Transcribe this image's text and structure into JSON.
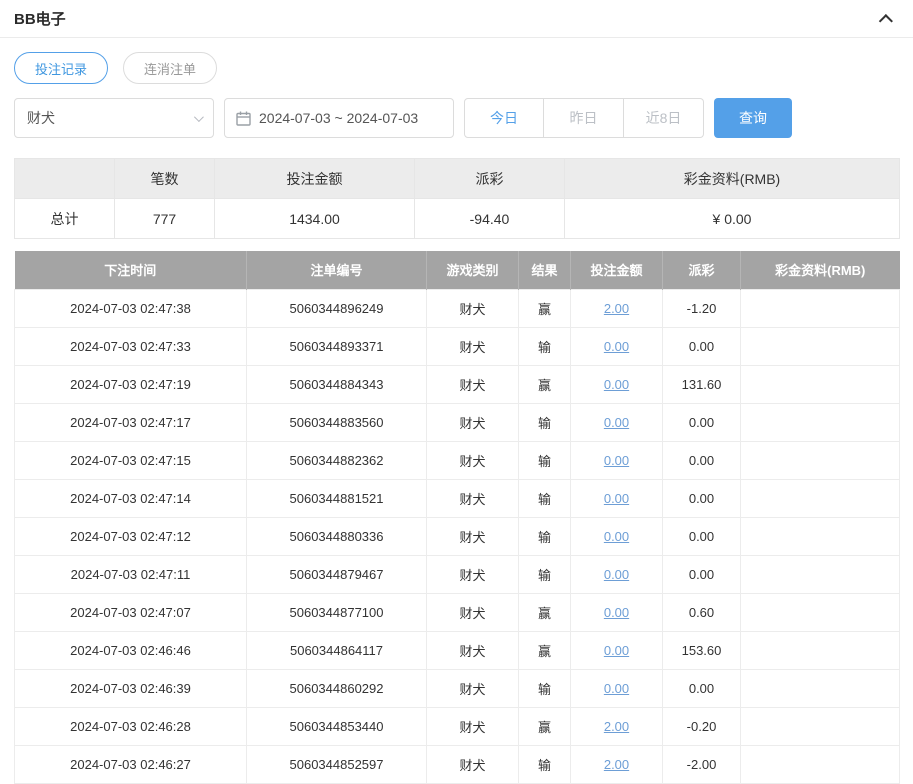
{
  "panel": {
    "title": "BB电子"
  },
  "tabs": {
    "bet_records": "投注记录",
    "cancelled_orders": "连消注单"
  },
  "filters": {
    "game_select_value": "财犬",
    "date_range_value": "2024-07-03 ~ 2024-07-03",
    "btn_today": "今日",
    "btn_yesterday": "昨日",
    "btn_last8": "近8日",
    "btn_search": "查询"
  },
  "summary": {
    "headers": {
      "blank": "",
      "count": "笔数",
      "bet_amount": "投注金额",
      "payout": "派彩",
      "bonus": "彩金资料(RMB)"
    },
    "total_label": "总计",
    "count": "777",
    "bet_amount": "1434.00",
    "payout": "-94.40",
    "bonus": "¥ 0.00"
  },
  "table": {
    "headers": [
      "下注时间",
      "注单编号",
      "游戏类别",
      "结果",
      "投注金额",
      "派彩",
      "彩金资料(RMB)"
    ],
    "rows": [
      {
        "time": "2024-07-03 02:47:38",
        "order_id": "5060344896249",
        "game": "财犬",
        "result": "赢",
        "amount": "2.00",
        "payout": "-1.20",
        "bonus": ""
      },
      {
        "time": "2024-07-03 02:47:33",
        "order_id": "5060344893371",
        "game": "财犬",
        "result": "输",
        "amount": "0.00",
        "payout": "0.00",
        "bonus": ""
      },
      {
        "time": "2024-07-03 02:47:19",
        "order_id": "5060344884343",
        "game": "财犬",
        "result": "赢",
        "amount": "0.00",
        "payout": "131.60",
        "bonus": ""
      },
      {
        "time": "2024-07-03 02:47:17",
        "order_id": "5060344883560",
        "game": "财犬",
        "result": "输",
        "amount": "0.00",
        "payout": "0.00",
        "bonus": ""
      },
      {
        "time": "2024-07-03 02:47:15",
        "order_id": "5060344882362",
        "game": "财犬",
        "result": "输",
        "amount": "0.00",
        "payout": "0.00",
        "bonus": ""
      },
      {
        "time": "2024-07-03 02:47:14",
        "order_id": "5060344881521",
        "game": "财犬",
        "result": "输",
        "amount": "0.00",
        "payout": "0.00",
        "bonus": ""
      },
      {
        "time": "2024-07-03 02:47:12",
        "order_id": "5060344880336",
        "game": "财犬",
        "result": "输",
        "amount": "0.00",
        "payout": "0.00",
        "bonus": ""
      },
      {
        "time": "2024-07-03 02:47:11",
        "order_id": "5060344879467",
        "game": "财犬",
        "result": "输",
        "amount": "0.00",
        "payout": "0.00",
        "bonus": ""
      },
      {
        "time": "2024-07-03 02:47:07",
        "order_id": "5060344877100",
        "game": "财犬",
        "result": "赢",
        "amount": "0.00",
        "payout": "0.60",
        "bonus": ""
      },
      {
        "time": "2024-07-03 02:46:46",
        "order_id": "5060344864117",
        "game": "财犬",
        "result": "赢",
        "amount": "0.00",
        "payout": "153.60",
        "bonus": ""
      },
      {
        "time": "2024-07-03 02:46:39",
        "order_id": "5060344860292",
        "game": "财犬",
        "result": "输",
        "amount": "0.00",
        "payout": "0.00",
        "bonus": ""
      },
      {
        "time": "2024-07-03 02:46:28",
        "order_id": "5060344853440",
        "game": "财犬",
        "result": "赢",
        "amount": "2.00",
        "payout": "-0.20",
        "bonus": ""
      },
      {
        "time": "2024-07-03 02:46:27",
        "order_id": "5060344852597",
        "game": "财犬",
        "result": "输",
        "amount": "2.00",
        "payout": "-2.00",
        "bonus": ""
      }
    ]
  },
  "colors": {
    "accent_blue": "#54a0e8",
    "link_blue": "#6d9ed6",
    "negative_red": "#e25d6c",
    "table_header_gray": "#a4a4a4",
    "summary_header_gray": "#ececec"
  }
}
